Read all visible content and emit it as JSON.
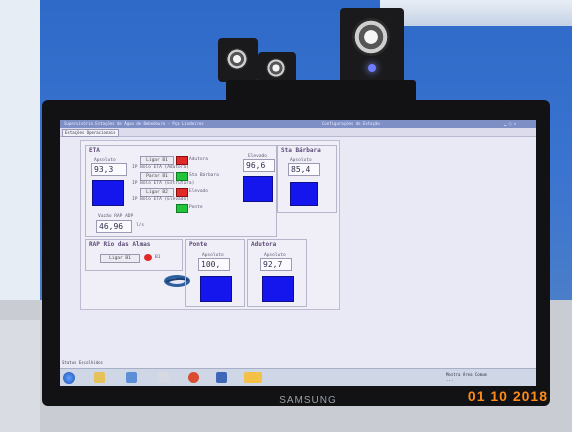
{
  "photo": {
    "monitor_brand": "SAMSUNG",
    "date_stamp": "01 10 2018"
  },
  "window": {
    "title": "Supervisório Estações de Água de Bebedouro - Pça Lindeiros",
    "title_center": "Configurações de Estação",
    "tab": "Estações Operacionais"
  },
  "eta": {
    "title": "ETA",
    "apsoluto_label": "Apsoluto",
    "level_value": "93,3",
    "rows": [
      {
        "button": "Ligar B1",
        "label": "Adutora",
        "status_color": "#e02a2a"
      },
      {
        "caption": "IP Bolo ETA (Adutora)"
      },
      {
        "button": "Parar B1",
        "label": "Sta Bárbara",
        "status_color": "#23c43b"
      },
      {
        "caption": "IP Bolo ETA (Estrutura)"
      },
      {
        "button": "Ligar B2",
        "label": "Elevado",
        "status_color": "#e02a2a"
      },
      {
        "caption": "IP Bolo ETA (Elevado)"
      },
      {
        "button": "",
        "label": "Ponte",
        "status_color": "#23c43b"
      }
    ],
    "flow_label": "Vazão RAP ADP",
    "flow_value": "46,96",
    "flow_unit": "l/s"
  },
  "elevado": {
    "label": "Elevado",
    "value": "96,6"
  },
  "sta_barbara": {
    "title": "Sta Bárbara",
    "label": "Apsoluto",
    "value": "85,4"
  },
  "rap_rio": {
    "title": "RAP Rio das Almas",
    "button": "Ligar B1",
    "indicator_label": "B1"
  },
  "ponte": {
    "title": "Ponte",
    "label": "Apsoluto",
    "value": "100,"
  },
  "adutora": {
    "title": "Adutora",
    "label": "Apsoluto",
    "value": "92,7"
  },
  "taskbar": {
    "status": "Status Escolhidos",
    "tray_line1": "Mostra Área Comum",
    "tray_line2": "..."
  }
}
